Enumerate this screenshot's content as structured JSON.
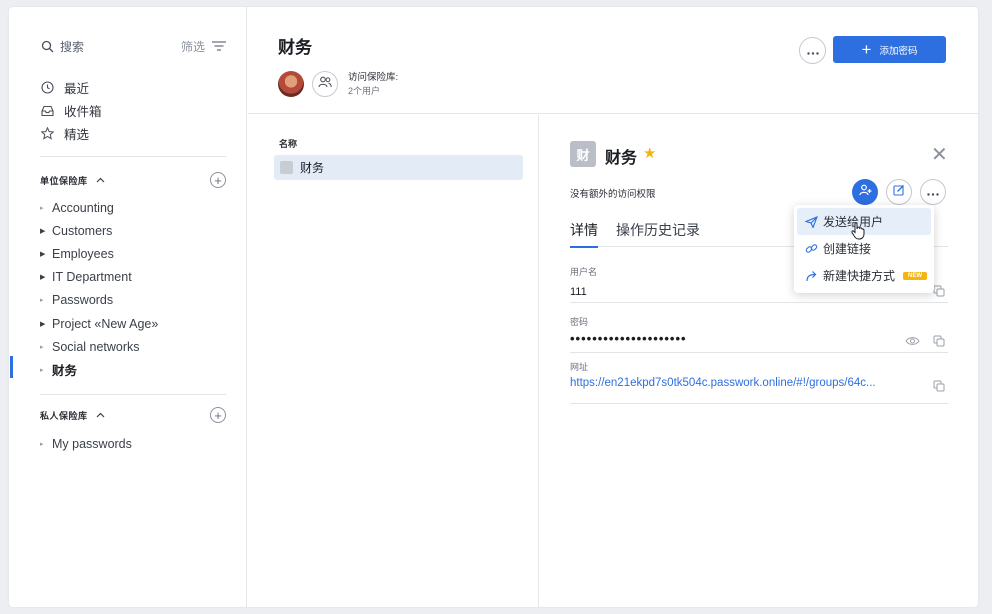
{
  "sidebar": {
    "search_placeholder": "搜索",
    "filter_label": "筛选",
    "nav": [
      {
        "label": "最近",
        "icon": "clock-icon"
      },
      {
        "label": "收件箱",
        "icon": "inbox-icon"
      },
      {
        "label": "精选",
        "icon": "star-icon"
      }
    ],
    "org_section_title": "单位保险库",
    "org_vaults": [
      "Accounting",
      "Customers",
      "Employees",
      "IT Department",
      "Passwords",
      "Project «New Age»",
      "Social networks",
      "财务"
    ],
    "private_section_title": "私人保险库",
    "private_vaults": [
      "My passwords"
    ]
  },
  "header": {
    "title": "财务",
    "access_label": "访问保险库:",
    "access_sub": "2个用户",
    "add_button": "添加密码"
  },
  "list": {
    "column_name": "名称",
    "items": [
      "财务"
    ]
  },
  "details": {
    "badge": "财",
    "title": "财务",
    "access_text": "没有额外的访问权限",
    "tabs": [
      "详情",
      "操作历史记录"
    ],
    "fields": {
      "username_label": "用户名",
      "username_value": "111",
      "password_label": "密码",
      "password_value": "•••••••••••••••••••••",
      "url_label": "网址",
      "url_value": "https://en21ekpd7s0tk504c.passwork.online/#!/groups/64c..."
    }
  },
  "menu": {
    "items": [
      "发送给用户",
      "创建链接",
      "新建快捷方式"
    ],
    "new_badge": "NEW"
  },
  "colors": {
    "accent": "#2d6fe0",
    "star": "#f5b50a",
    "selected_row": "#e2ebf6"
  }
}
